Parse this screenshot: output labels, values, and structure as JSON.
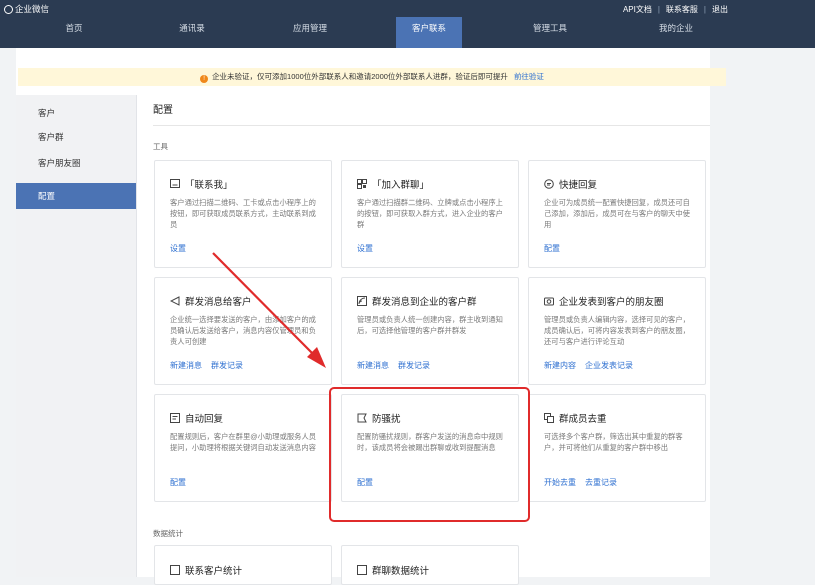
{
  "app": {
    "name": "企业微信"
  },
  "toplinks": {
    "api_docs": "API文档",
    "contact_service": "联系客服",
    "logout": "退出",
    "separator": "|"
  },
  "nav": {
    "home": "首页",
    "contacts": "通讯录",
    "apps": "应用管理",
    "customer_contact": "客户联系",
    "tools": "管理工具",
    "my_company": "我的企业"
  },
  "notice": {
    "text": "企业未验证，仅可添加1000位外部联系人和邀请2000位外部联系人进群，验证后即可提升",
    "link": "前往验证"
  },
  "sidebar": {
    "items": [
      "客户",
      "客户群",
      "客户朋友圈",
      "配置"
    ],
    "active": "配置"
  },
  "page": {
    "title": "配置",
    "section_tools": "工具",
    "section_stats": "数据统计"
  },
  "cards": [
    {
      "title": "「联系我」",
      "icon": "qr-icon",
      "desc": "客户通过扫描二维码、工卡或点击小程序上的按钮，即可获取成员联系方式，主动联系到成员",
      "links": [
        "设置"
      ]
    },
    {
      "title": "「加入群聊」",
      "icon": "group-qr-icon",
      "desc": "客户通过扫描群二维码、立牌或点击小程序上的按钮，即可获取入群方式，进入企业的客户群",
      "links": [
        "设置"
      ]
    },
    {
      "title": "快捷回复",
      "icon": "quick-reply-icon",
      "desc": "企业可为成员统一配置快捷回复，成员还可自己添加，添加后，成员可在与客户的聊天中使用",
      "links": [
        "配置"
      ]
    },
    {
      "title": "群发消息给客户",
      "icon": "megaphone-icon",
      "desc": "企业统一选择要发送的客户，由添加客户的成员确认后发送给客户，消息内容仅管理员和负责人可创建",
      "links": [
        "新建消息",
        "群发记录"
      ]
    },
    {
      "title": "群发消息到企业的客户群",
      "icon": "broadcast-icon",
      "desc": "管理员或负责人统一创建内容，群主收到通知后，可选择他管理的客户群并群发",
      "links": [
        "新建消息",
        "群发记录"
      ]
    },
    {
      "title": "企业发表到客户的朋友圈",
      "icon": "camera-icon",
      "desc": "管理员或负责人编辑内容，选择可见的客户，成员确认后，可将内容发表到客户的朋友圈，还可与客户进行评论互动",
      "links": [
        "新建内容",
        "企业发表记录"
      ]
    },
    {
      "title": "自动回复",
      "icon": "auto-reply-icon",
      "desc": "配置规则后，客户在群里@小助理或服务人员提问，小助理将根据关键词自动发送消息内容",
      "links": [
        "配置"
      ]
    },
    {
      "title": "防骚扰",
      "icon": "shield-flag-icon",
      "desc": "配置防骚扰规则，群客户发送的消息命中规则时，该成员将会被踢出群聊或收到提醒消息",
      "links": [
        "配置"
      ]
    },
    {
      "title": "群成员去重",
      "icon": "dedupe-icon",
      "desc": "可选择多个客户群，筛选出其中重复的群客户，并可将他们从重复的客户群中移出",
      "links": [
        "开始去重",
        "去重记录"
      ]
    },
    {
      "title": "联系客户统计",
      "icon": "chart-icon",
      "desc": "",
      "links": []
    },
    {
      "title": "群聊数据统计",
      "icon": "chart-icon",
      "desc": "",
      "links": []
    }
  ],
  "colors": {
    "topbar": "#2b3b52",
    "accent": "#4b73b4",
    "link": "#2d6fd0",
    "highlight": "#e02b2b",
    "notice_bg": "#fff7d9"
  }
}
